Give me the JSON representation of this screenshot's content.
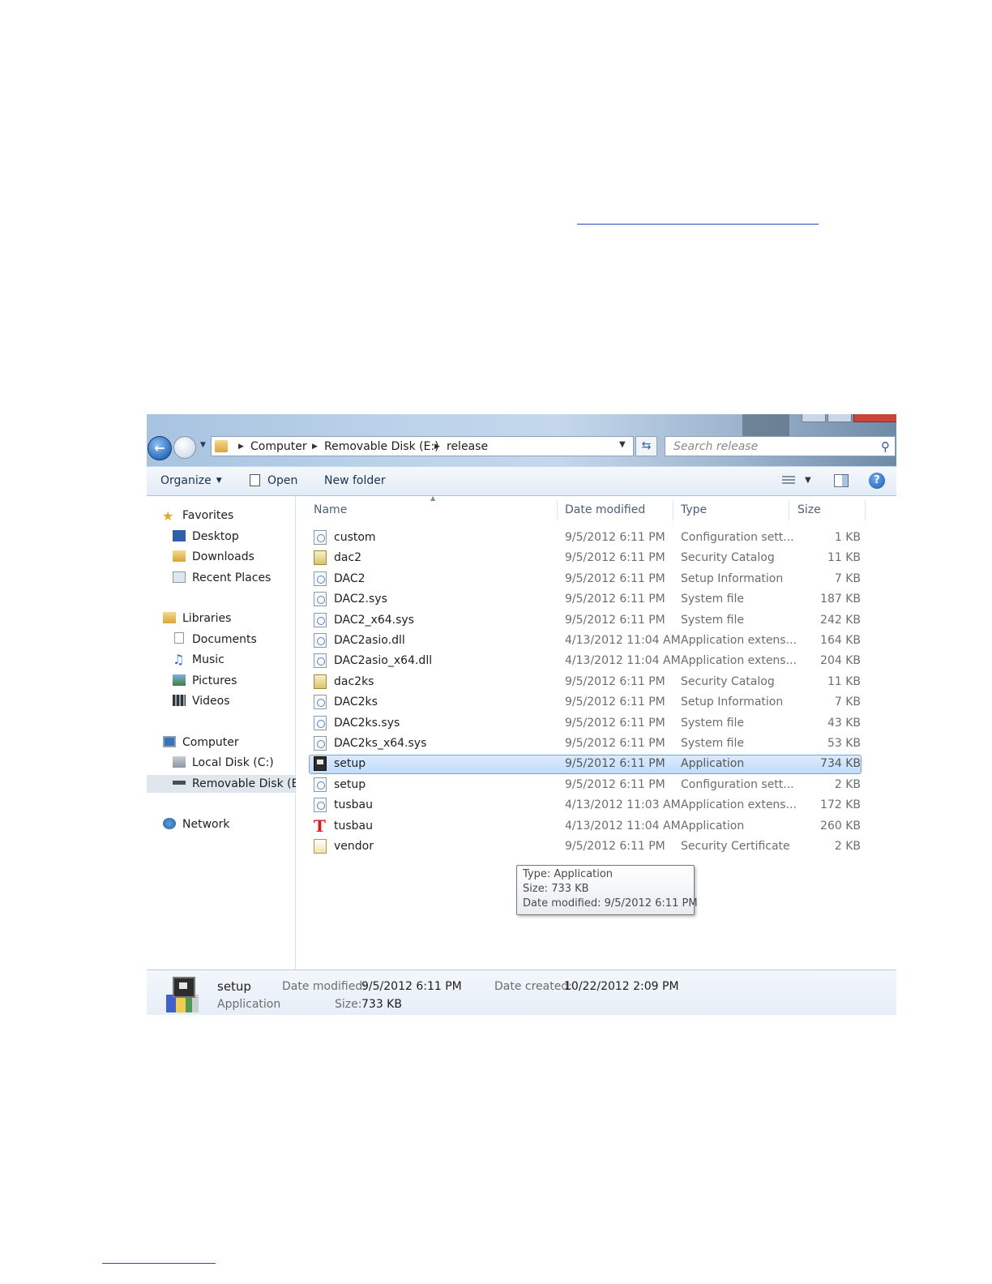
{
  "address": {
    "crumbs": [
      "Computer",
      "Removable Disk (E:)",
      "release"
    ]
  },
  "search": {
    "placeholder": "Search release"
  },
  "toolbar": {
    "organize": "Organize",
    "open": "Open",
    "new_folder": "New folder"
  },
  "nav": {
    "favorites": "Favorites",
    "desktop": "Desktop",
    "downloads": "Downloads",
    "recent_places": "Recent Places",
    "libraries": "Libraries",
    "documents": "Documents",
    "music": "Music",
    "pictures": "Pictures",
    "videos": "Videos",
    "computer": "Computer",
    "local_disk": "Local Disk (C:)",
    "removable_disk": "Removable Disk (E:)",
    "network": "Network"
  },
  "columns": {
    "name": "Name",
    "date_modified": "Date modified",
    "type": "Type",
    "size": "Size"
  },
  "files": [
    {
      "name": "custom",
      "date": "9/5/2012 6:11 PM",
      "type": "Configuration sett...",
      "size": "1 KB",
      "icon": "cfg"
    },
    {
      "name": "dac2",
      "date": "9/5/2012 6:11 PM",
      "type": "Security Catalog",
      "size": "11 KB",
      "icon": "catalog"
    },
    {
      "name": "DAC2",
      "date": "9/5/2012 6:11 PM",
      "type": "Setup Information",
      "size": "7 KB",
      "icon": "inf"
    },
    {
      "name": "DAC2.sys",
      "date": "9/5/2012 6:11 PM",
      "type": "System file",
      "size": "187 KB",
      "icon": "sys"
    },
    {
      "name": "DAC2_x64.sys",
      "date": "9/5/2012 6:11 PM",
      "type": "System file",
      "size": "242 KB",
      "icon": "sys"
    },
    {
      "name": "DAC2asio.dll",
      "date": "4/13/2012 11:04 AM",
      "type": "Application extens...",
      "size": "164 KB",
      "icon": "dll"
    },
    {
      "name": "DAC2asio_x64.dll",
      "date": "4/13/2012 11:04 AM",
      "type": "Application extens...",
      "size": "204 KB",
      "icon": "dll"
    },
    {
      "name": "dac2ks",
      "date": "9/5/2012 6:11 PM",
      "type": "Security Catalog",
      "size": "11 KB",
      "icon": "catalog"
    },
    {
      "name": "DAC2ks",
      "date": "9/5/2012 6:11 PM",
      "type": "Setup Information",
      "size": "7 KB",
      "icon": "inf"
    },
    {
      "name": "DAC2ks.sys",
      "date": "9/5/2012 6:11 PM",
      "type": "System file",
      "size": "43 KB",
      "icon": "sys"
    },
    {
      "name": "DAC2ks_x64.sys",
      "date": "9/5/2012 6:11 PM",
      "type": "System file",
      "size": "53 KB",
      "icon": "sys"
    },
    {
      "name": "setup",
      "date": "9/5/2012 6:11 PM",
      "type": "Application",
      "size": "734 KB",
      "icon": "app",
      "selected": true
    },
    {
      "name": "setup",
      "date": "9/5/2012 6:11 PM",
      "type": "Configuration sett...",
      "size": "2 KB",
      "icon": "cfg"
    },
    {
      "name": "tusbau",
      "date": "4/13/2012 11:03 AM",
      "type": "Application extens...",
      "size": "172 KB",
      "icon": "dll"
    },
    {
      "name": "tusbau",
      "date": "4/13/2012 11:04 AM",
      "type": "Application",
      "size": "260 KB",
      "icon": "redt"
    },
    {
      "name": "vendor",
      "date": "9/5/2012 6:11 PM",
      "type": "Security Certificate",
      "size": "2 KB",
      "icon": "cert"
    }
  ],
  "tooltip": {
    "type_line": "Type: Application",
    "size_line": "Size: 733 KB",
    "date_line": "Date modified: 9/5/2012 6:11 PM"
  },
  "details": {
    "name": "setup",
    "kind": "Application",
    "date_modified_label": "Date modified:",
    "date_modified": "9/5/2012 6:11 PM",
    "size_label": "Size:",
    "size": "733 KB",
    "date_created_label": "Date created:",
    "date_created": "10/22/2012 2:09 PM"
  },
  "icons": {
    "back": "back-arrow-icon",
    "forward": "forward-arrow-icon",
    "refresh": "refresh-icon",
    "search": "search-icon",
    "help": "help-icon"
  }
}
